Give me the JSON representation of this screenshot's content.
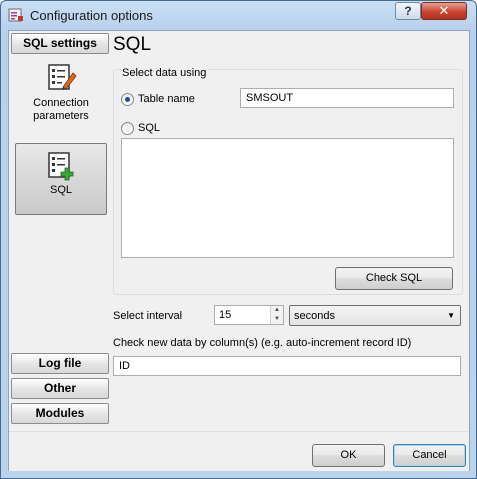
{
  "window": {
    "title": "Configuration options",
    "help_label": "?",
    "close_label": "✕"
  },
  "sidebar": {
    "top_button": "SQL settings",
    "items": [
      {
        "label": "Connection parameters",
        "icon": "connection-icon"
      },
      {
        "label": "SQL",
        "icon": "sql-add-icon"
      }
    ],
    "bottom_buttons": [
      "Log file",
      "Other",
      "Modules"
    ]
  },
  "main": {
    "title": "SQL",
    "group_label": "Select data using",
    "table_name_label": "Table name",
    "table_name_value": "SMSOUT",
    "sql_label": "SQL",
    "sql_value": "",
    "check_sql_button": "Check SQL",
    "interval_label": "Select interval",
    "interval_value": "15",
    "interval_unit": "seconds",
    "check_column_label": "Check new data by column(s) (e.g. auto-increment record ID)",
    "check_column_value": "ID"
  },
  "footer": {
    "ok_button": "OK",
    "cancel_button": "Cancel"
  },
  "colors": {
    "accent": "#1f4e9e",
    "frame": "#bcd3ee",
    "close": "#c8452f",
    "plus_green": "#3aa83a",
    "pencil_orange": "#e06a1c"
  }
}
